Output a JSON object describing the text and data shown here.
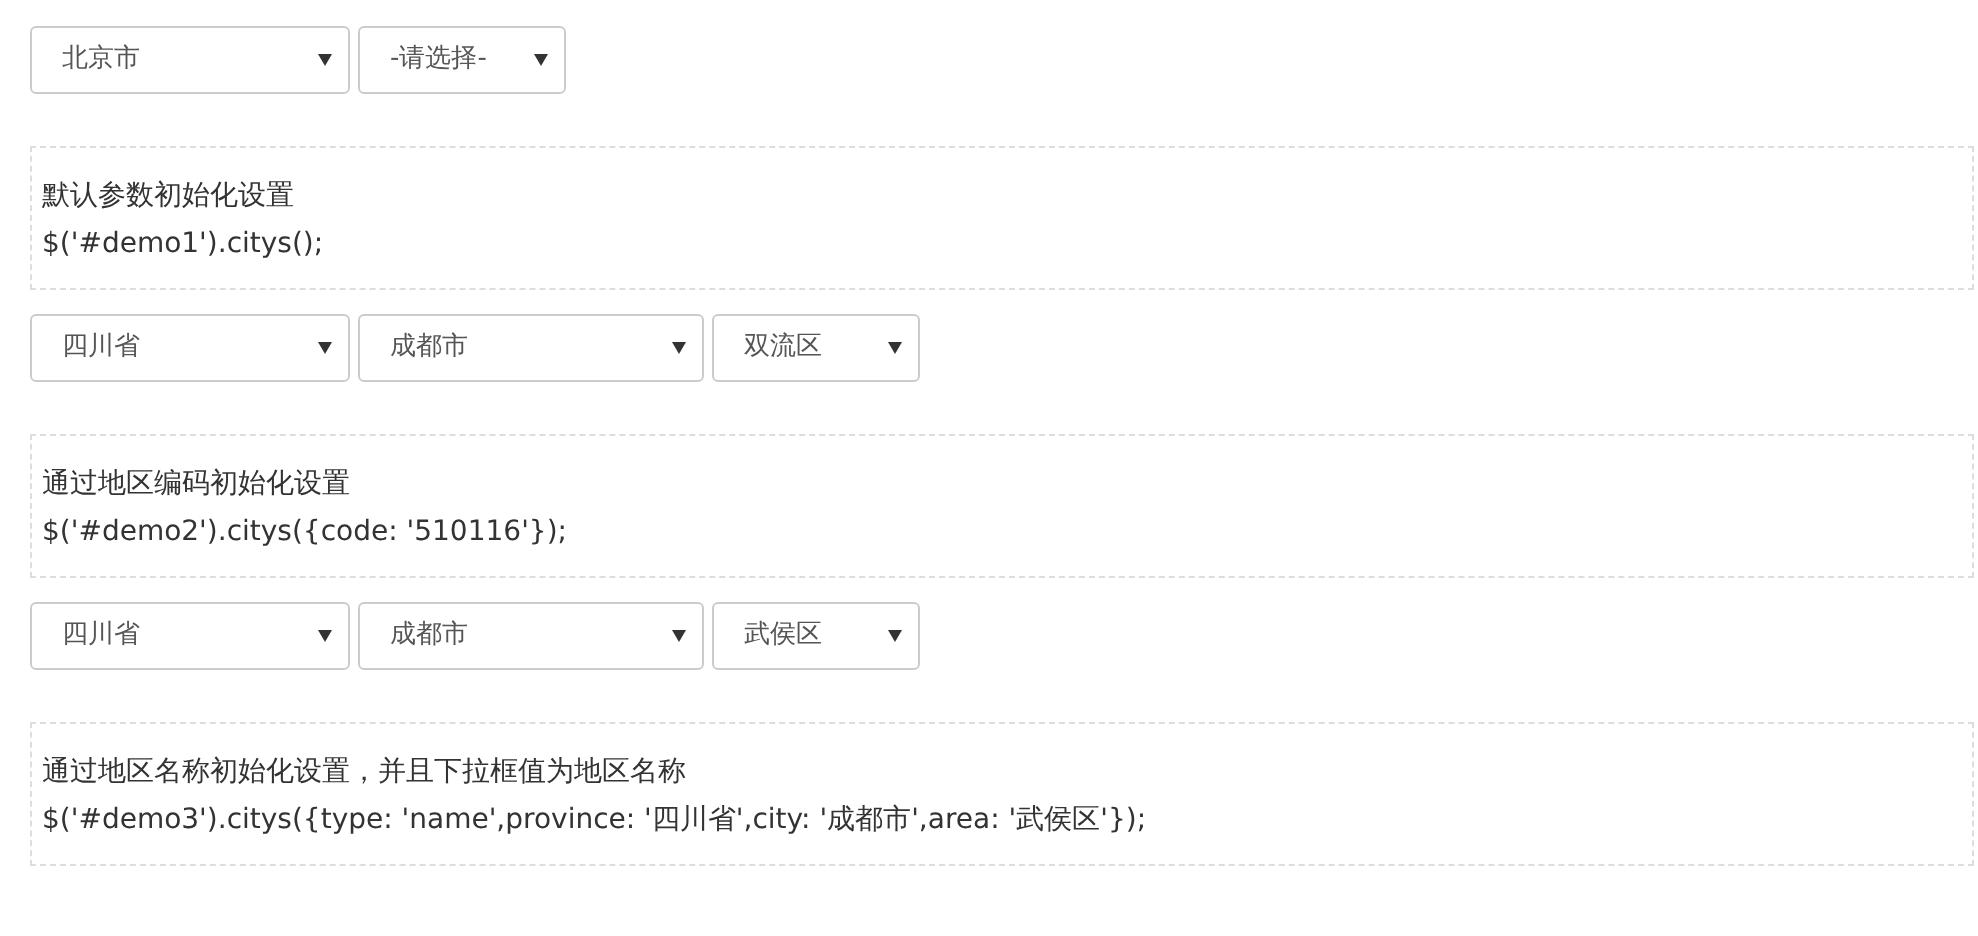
{
  "demos": [
    {
      "selects": [
        {
          "value": "北京市"
        },
        {
          "value": "-请选择-"
        }
      ],
      "note": {
        "title": "默认参数初始化设置",
        "code": "$('#demo1').citys();"
      }
    },
    {
      "selects": [
        {
          "value": "四川省"
        },
        {
          "value": "成都市"
        },
        {
          "value": "双流区"
        }
      ],
      "note": {
        "title": "通过地区编码初始化设置",
        "code": "$('#demo2').citys({code: '510116'});"
      }
    },
    {
      "selects": [
        {
          "value": "四川省"
        },
        {
          "value": "成都市"
        },
        {
          "value": "武侯区"
        }
      ],
      "note": {
        "title": "通过地区名称初始化设置，并且下拉框值为地区名称",
        "code": "$('#demo3').citys({type: 'name',province: '四川省',city: '成都市',area: '武侯区'});"
      }
    }
  ]
}
